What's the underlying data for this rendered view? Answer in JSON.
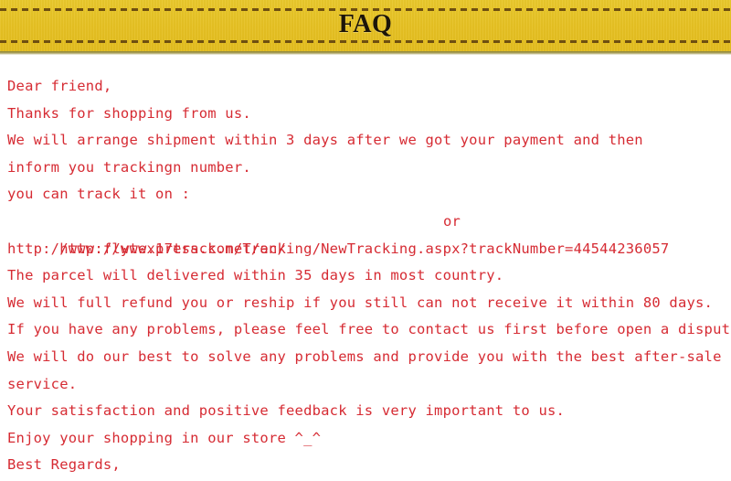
{
  "header": {
    "title": "FAQ",
    "banner_color": "#e8c526",
    "dash_color": "#6e4f10",
    "title_color": "#1d1509"
  },
  "body": {
    "text_color": "#d62b33",
    "lines": [
      "Dear friend,",
      "Thanks for shopping from us.",
      "We will arrange shipment within 3 days after we got your payment and then",
      "inform you trackingn number.",
      "you can track it on :",
      "http://www.17track.net/en/",
      "http://www.flytexpress.com/Tracking/NewTracking.aspx?trackNumber=44544236057",
      "The parcel will delivered within 35 days in most country.",
      "We will full refund you or reship if you still can not receive it within 80 days.",
      "If you have any problems, please feel free to contact us first before open a dispute.",
      "We will do our best to solve any problems and provide you with the best after-sale",
      "service.",
      "Your satisfaction and positive feedback is very important to us.",
      "Enjoy your shopping in our store ^_^",
      "Best Regards,"
    ],
    "or_label": "or"
  }
}
